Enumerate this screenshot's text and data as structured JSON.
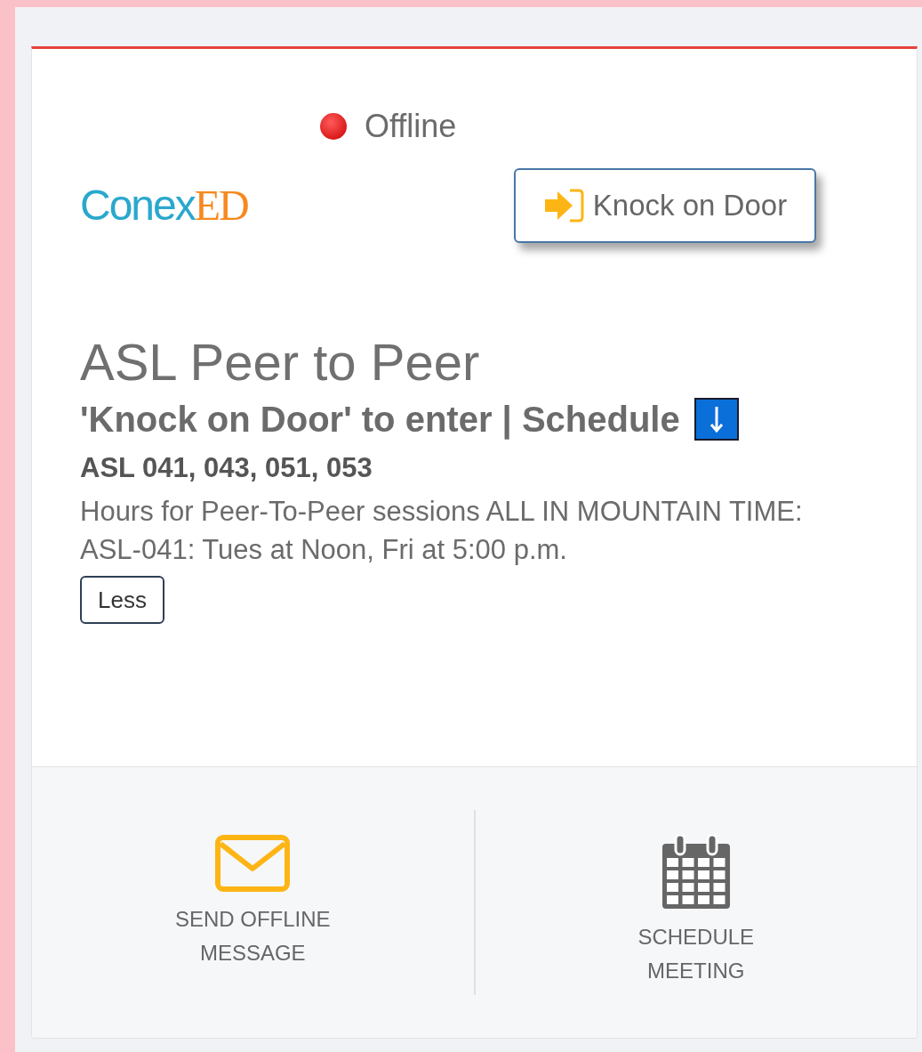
{
  "status": {
    "label": "Offline",
    "online": false
  },
  "logo": {
    "first": "Conex",
    "second": "ED"
  },
  "knock_button": {
    "label": "Knock on Door"
  },
  "title": "ASL Peer to Peer",
  "subtitle": "'Knock on Door' to enter | Schedule",
  "courses": "ASL 041, 043, 051, 053",
  "description": "Hours for Peer-To-Peer sessions ALL IN MOUNTAIN TIME: ASL-041: Tues at Noon, Fri at 5:00 p.m.",
  "toggle_button": {
    "label": "Less",
    "expanded": true
  },
  "actions": [
    {
      "kind": "message",
      "label": "SEND OFFLINE MESSAGE"
    },
    {
      "kind": "calendar",
      "label": "SCHEDULE MEETING"
    }
  ]
}
